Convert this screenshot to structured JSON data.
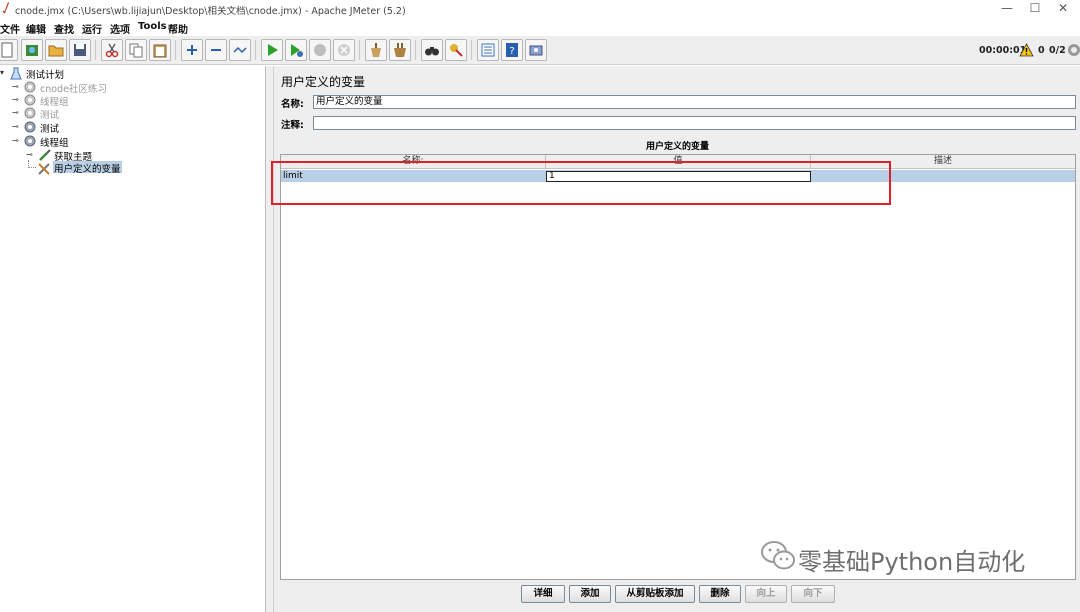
{
  "window": {
    "title": "cnode.jmx (C:\\Users\\wb.lijiajun\\Desktop\\相关文档\\cnode.jmx) - Apache JMeter (5.2)",
    "minimize_glyph": "—",
    "maximize_glyph": "☐",
    "close_glyph": "✕"
  },
  "menubar": {
    "items": [
      "文件",
      "编辑",
      "查找",
      "运行",
      "选项",
      "Tools",
      "帮助"
    ]
  },
  "toolbar": {
    "elapsed": "00:00:01",
    "warnings": "0",
    "threads": "0/2"
  },
  "tree": {
    "items": [
      {
        "label": "测试计划",
        "icon": "flask-icon",
        "muted": false
      },
      {
        "label": "cnode社区练习",
        "icon": "gear-icon",
        "muted": true
      },
      {
        "label": "线程组",
        "icon": "gear-icon",
        "muted": true
      },
      {
        "label": "测试",
        "icon": "gear-icon",
        "muted": true
      },
      {
        "label": "测试",
        "icon": "gear-icon",
        "muted": false
      },
      {
        "label": "线程组",
        "icon": "gear-icon",
        "muted": false
      },
      {
        "label": "获取主题",
        "icon": "pipette-icon",
        "muted": false
      },
      {
        "label": "用户定义的变量",
        "icon": "tools-icon",
        "muted": false,
        "selected": true
      }
    ]
  },
  "panel": {
    "heading": "用户定义的变量",
    "name_label": "名称:",
    "name_value": "用户定义的变量",
    "comment_label": "注释:",
    "comment_value": "",
    "table_title": "用户定义的变量",
    "columns": [
      "名称:",
      "值",
      "描述"
    ],
    "rows": [
      {
        "name": "limit",
        "value": "1",
        "description": ""
      }
    ]
  },
  "buttons": {
    "detail": "详细",
    "add": "添加",
    "add_from_clipboard": "从剪贴板添加",
    "delete": "删除",
    "up": "向上",
    "down": "向下"
  },
  "watermark": {
    "text": "零基础Python自动化"
  },
  "colors": {
    "highlight_box": "#e0202a",
    "selection": "#b8cfe5",
    "tree_selection": "#b8cfe5"
  }
}
